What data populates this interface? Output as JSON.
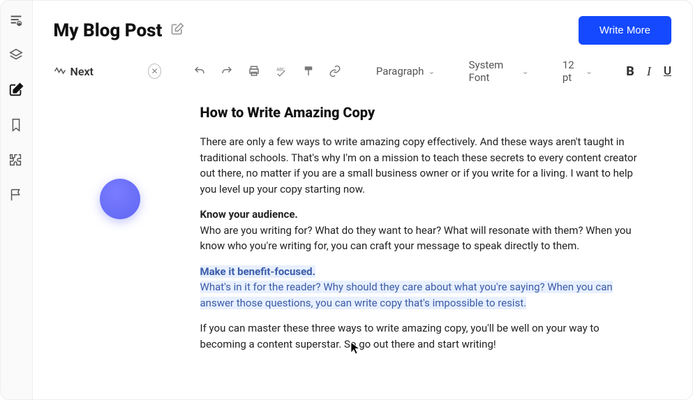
{
  "sidebar": {
    "items": [
      {
        "name": "logo"
      },
      {
        "name": "layers"
      },
      {
        "name": "compose",
        "active": true
      },
      {
        "name": "bookmark"
      },
      {
        "name": "puzzle"
      },
      {
        "name": "flag"
      }
    ]
  },
  "header": {
    "title": "My Blog Post",
    "write_more": "Write More"
  },
  "toolbar": {
    "next": "Next",
    "paragraph": "Paragraph",
    "font": "System Font",
    "size": "12 pt",
    "bold": "B",
    "italic": "I",
    "underline": "U"
  },
  "doc": {
    "heading": "How to Write Amazing Copy",
    "p1": "There are only a few ways to write amazing copy effectively. And these ways aren't taught in traditional schools. That's why I'm on a mission to teach these secrets to every content creator out there, no matter if you are a small business owner or if you write for a living. I want to help you level up your copy starting now.",
    "p2_title": "Know your audience.",
    "p2_body": "Who are you writing for? What do they want to hear? What will resonate with them? When you know who you're writing for, you can craft your message to speak directly to them.",
    "p3_title": "Make it benefit-focused.",
    "p3_body": "What's in it for the reader? Why should they care about what you're saying? When you can answer those questions, you can write copy that's impossible to resist.",
    "p4_a": "If you can master these three ways to write amazing copy, you'll be well on your way to becoming a content superstar. S",
    "p4_b": "o go out there and start writing!"
  }
}
